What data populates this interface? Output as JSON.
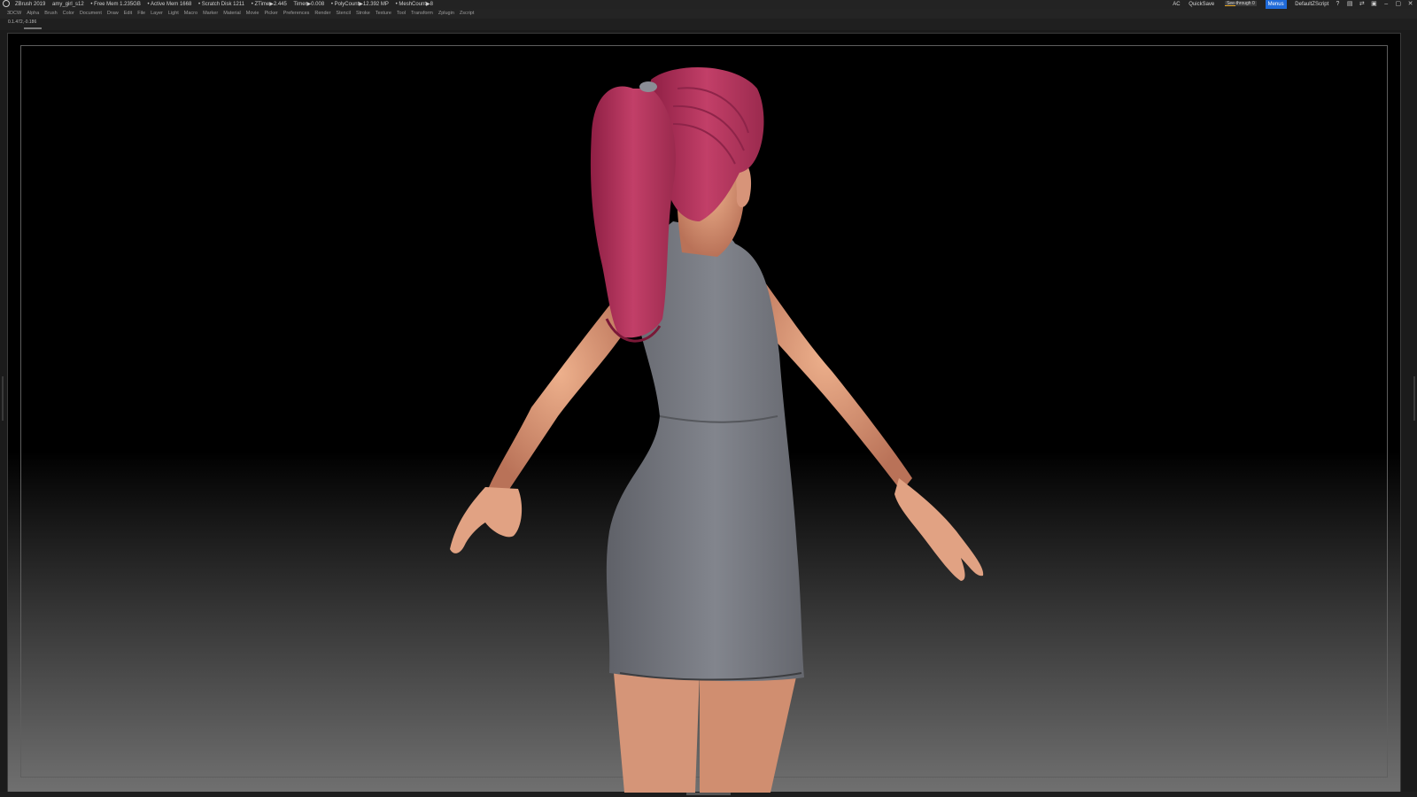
{
  "app": {
    "name": "ZBrush 2019",
    "document": "amy_girl_s12"
  },
  "status": {
    "free_mem": "• Free Mem 1.235GB",
    "active_mem": "• Active Mem 1668",
    "scratch_disk": "• Scratch Disk 1211",
    "ztime": "• ZTime▶2.445",
    "timer": "Timer▶0.008",
    "polycount": "• PolyCount▶12.392 MP",
    "meshcount": "• MeshCount▶8"
  },
  "toolbar_right": {
    "ac": "AC",
    "quicksave": "QuickSave",
    "see_through_label": "See-through 0",
    "see_through_value": 0,
    "menus_label": "Menus",
    "script_label": "DefaultZScript"
  },
  "menubar": {
    "items": [
      "3DCW",
      "Alpha",
      "Brush",
      "Color",
      "Document",
      "Draw",
      "Edit",
      "File",
      "Layer",
      "Light",
      "Macro",
      "Marker",
      "Material",
      "Movie",
      "Picker",
      "Preferences",
      "Render",
      "Stencil",
      "Stroke",
      "Texture",
      "Tool",
      "Transform",
      "Zplugin",
      "Zscript"
    ]
  },
  "coordinates": "0.1.472,-0.186",
  "colors": {
    "accent_blue": "#1f6ad8",
    "slider_orange": "#e6a623",
    "hair": "#b8345e",
    "skin": "#d9987a",
    "dress": "#74777e"
  },
  "icons": [
    "help-icon",
    "layout-icon",
    "flip-icon",
    "lock-icon",
    "minimize-icon",
    "maximize-icon",
    "close-icon"
  ]
}
